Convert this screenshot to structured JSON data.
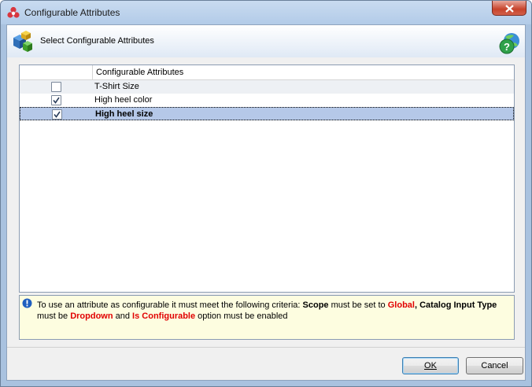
{
  "window": {
    "title": "Configurable Attributes"
  },
  "header": {
    "title": "Select Configurable Attributes"
  },
  "grid": {
    "column_header": "Configurable Attributes",
    "rows": [
      {
        "label": "T-Shirt Size",
        "checked": false,
        "selected": false
      },
      {
        "label": "High heel color",
        "checked": true,
        "selected": false
      },
      {
        "label": "High heel size",
        "checked": true,
        "selected": true
      }
    ]
  },
  "info": {
    "intro": "To use an attribute as configurable it must meet the following criteria: ",
    "scope_label": "Scope",
    "scope_mid": " must be set to ",
    "scope_value": "Global",
    "comma": ",",
    "catalog_label": "Catalog Input Type",
    "must_be": "must be ",
    "dropdown": "Dropdown",
    "and": " and ",
    "is_configurable": "Is Configurable",
    "tail": " option must be enabled"
  },
  "buttons": {
    "ok": "OK",
    "cancel": "Cancel"
  },
  "colors": {
    "accent_red": "#e10000",
    "selection": "#b5c8e8",
    "info_bg": "#fdfde0"
  }
}
